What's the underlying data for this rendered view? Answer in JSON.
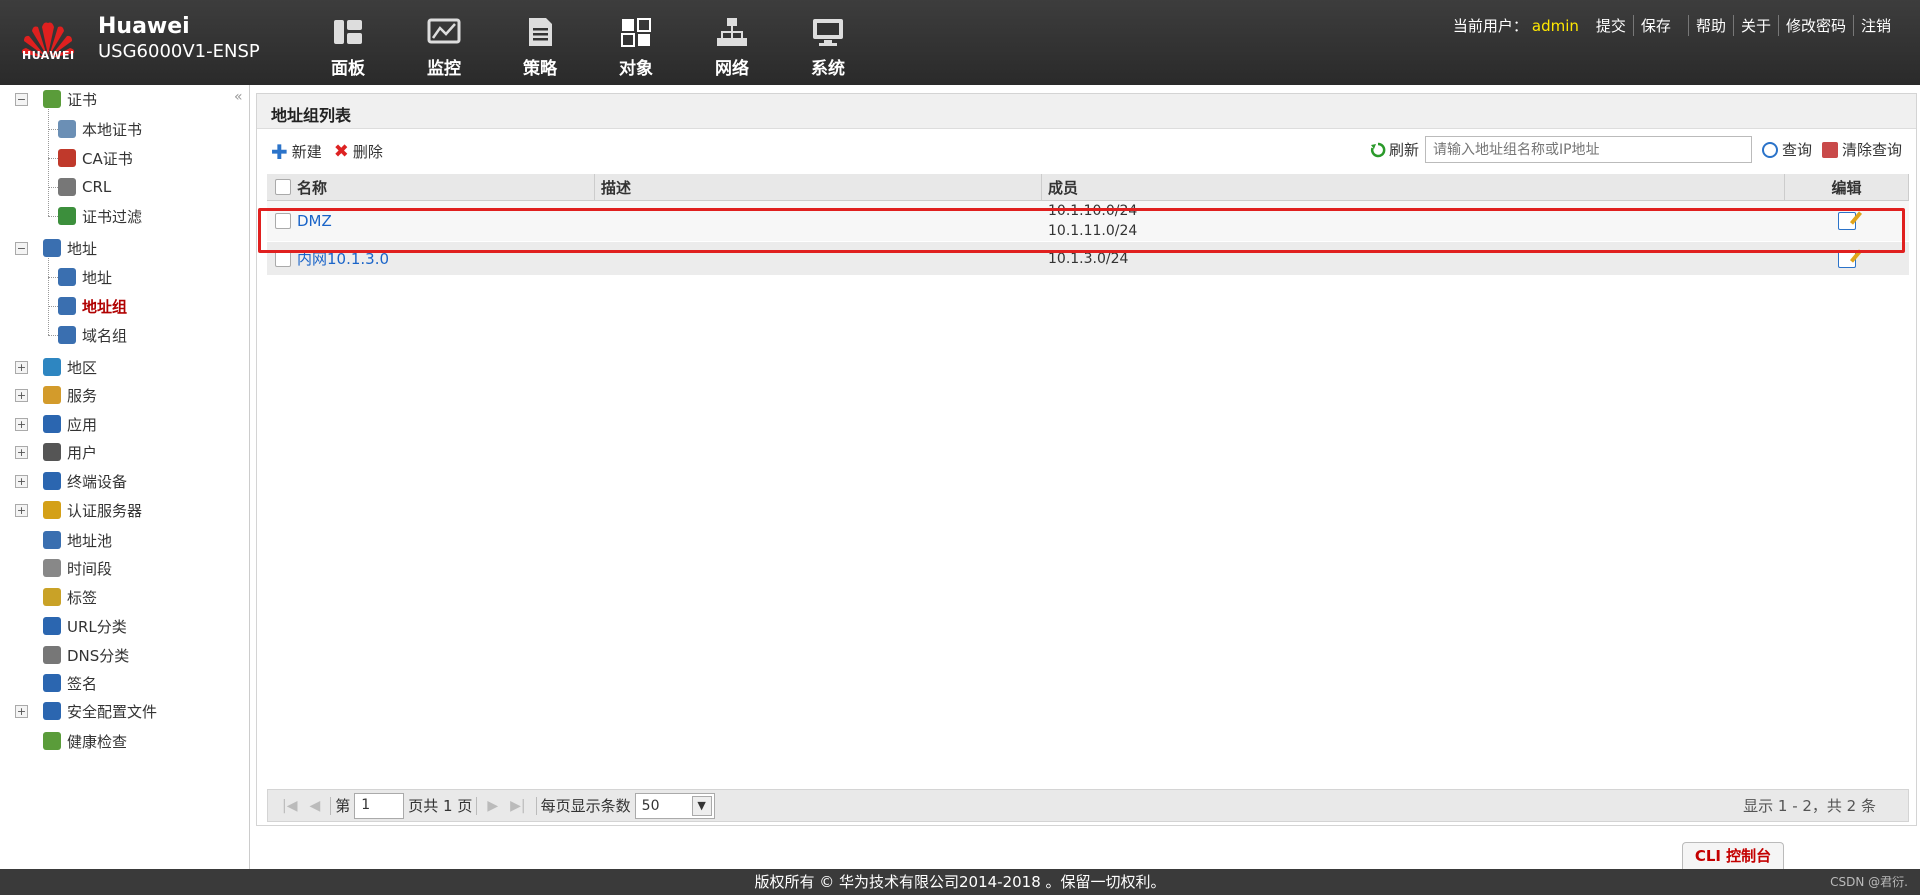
{
  "header": {
    "logo_text": "HUAWEI",
    "brand": "Huawei",
    "model": "USG6000V1-ENSP",
    "nav": [
      {
        "label": "面板",
        "icon": "dashboard-icon"
      },
      {
        "label": "监控",
        "icon": "monitor-icon"
      },
      {
        "label": "策略",
        "icon": "policy-icon"
      },
      {
        "label": "对象",
        "icon": "object-icon"
      },
      {
        "label": "网络",
        "icon": "network-icon"
      },
      {
        "label": "系统",
        "icon": "system-icon"
      }
    ],
    "current_user_label": "当前用户：",
    "current_user": "admin",
    "links": [
      "提交",
      "保存",
      "帮助",
      "关于",
      "修改密码",
      "注销"
    ]
  },
  "sidebar": {
    "items": [
      {
        "label": "证书",
        "level": 0,
        "expander": "−",
        "icon": "certificate-icon"
      },
      {
        "label": "本地证书",
        "level": 1,
        "icon": "local-certificate-icon"
      },
      {
        "label": "CA证书",
        "level": 1,
        "icon": "ca-certificate-icon"
      },
      {
        "label": "CRL",
        "level": 1,
        "icon": "crl-icon"
      },
      {
        "label": "证书过滤",
        "level": 1,
        "icon": "certificate-filter-icon"
      },
      {
        "label": "地址",
        "level": 0,
        "expander": "−",
        "icon": "address-icon"
      },
      {
        "label": "地址",
        "level": 1,
        "icon": "address-item-icon"
      },
      {
        "label": "地址组",
        "level": 1,
        "icon": "address-group-icon",
        "active": true
      },
      {
        "label": "域名组",
        "level": 1,
        "icon": "domain-group-icon"
      },
      {
        "label": "地区",
        "level": 0,
        "expander": "+",
        "icon": "region-icon"
      },
      {
        "label": "服务",
        "level": 0,
        "expander": "+",
        "icon": "service-icon"
      },
      {
        "label": "应用",
        "level": 0,
        "expander": "+",
        "icon": "application-icon"
      },
      {
        "label": "用户",
        "level": 0,
        "expander": "+",
        "icon": "user-icon"
      },
      {
        "label": "终端设备",
        "level": 0,
        "expander": "+",
        "icon": "terminal-device-icon"
      },
      {
        "label": "认证服务器",
        "level": 0,
        "expander": "+",
        "icon": "auth-server-icon"
      },
      {
        "label": "地址池",
        "level": 0,
        "icon": "address-pool-icon"
      },
      {
        "label": "时间段",
        "level": 0,
        "icon": "time-range-icon"
      },
      {
        "label": "标签",
        "level": 0,
        "icon": "tag-icon"
      },
      {
        "label": "URL分类",
        "level": 0,
        "icon": "url-category-icon"
      },
      {
        "label": "DNS分类",
        "level": 0,
        "icon": "dns-category-icon"
      },
      {
        "label": "签名",
        "level": 0,
        "icon": "signature-icon"
      },
      {
        "label": "安全配置文件",
        "level": 0,
        "expander": "+",
        "icon": "security-profile-icon"
      },
      {
        "label": "健康检查",
        "level": 0,
        "icon": "health-check-icon"
      }
    ]
  },
  "main": {
    "title": "地址组列表",
    "toolbar": {
      "new": "新建",
      "delete": "删除",
      "refresh": "刷新",
      "search_placeholder": "请输入地址组名称或IP地址",
      "query": "查询",
      "clear_query": "清除查询"
    },
    "columns": [
      "名称",
      "描述",
      "成员",
      "编辑"
    ],
    "rows": [
      {
        "name": "DMZ",
        "description": "",
        "members": [
          "10.1.10.0/24",
          "10.1.11.0/24"
        ]
      },
      {
        "name": "内网10.1.3.0",
        "description": "",
        "members": [
          "10.1.3.0/24"
        ]
      }
    ],
    "pager": {
      "page_prefix": "第",
      "page": "1",
      "page_suffix": "页共 1 页",
      "per_page_label": "每页显示条数",
      "per_page": "50",
      "summary": "显示 1 - 2，共 2 条"
    }
  },
  "cli_button": "CLI 控制台",
  "footer": {
    "copyright": "版权所有 © 华为技术有限公司2014-2018 。保留一切权利。",
    "watermark": "CSDN @君衍."
  },
  "colors": {
    "header_bg": "#333333",
    "user_name": "#ffe800",
    "active_item": "#b00000",
    "link": "#1a64c8",
    "highlight_border": "#e0201f"
  }
}
